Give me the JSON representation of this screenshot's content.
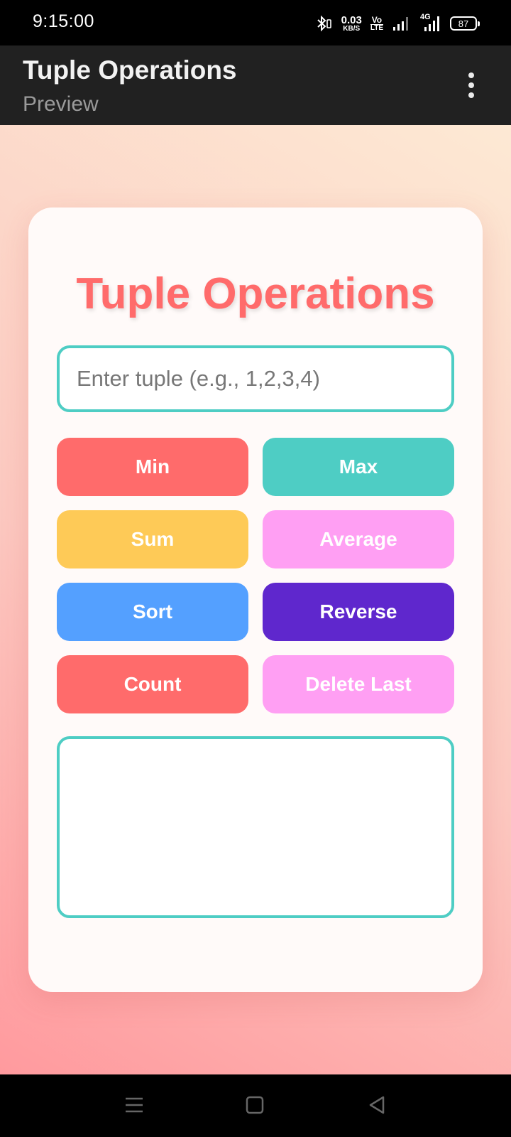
{
  "status_bar": {
    "time": "9:15:00",
    "net_speed_value": "0.03",
    "net_speed_unit": "KB/S",
    "volte_top": "Vo",
    "volte_bottom": "LTE",
    "network_type": "4G",
    "battery": "87",
    "icons": [
      "bluetooth-icon",
      "signal-icon",
      "signal-4g-icon",
      "battery-icon"
    ]
  },
  "app_bar": {
    "title": "Tuple Operations",
    "subtitle": "Preview",
    "menu_icon": "more-vertical-icon"
  },
  "card": {
    "title": "Tuple Operations",
    "input": {
      "value": "",
      "placeholder": "Enter tuple (e.g., 1,2,3,4)"
    },
    "buttons": [
      {
        "label": "Min",
        "color": "#ff6b6b"
      },
      {
        "label": "Max",
        "color": "#4ecdc4"
      },
      {
        "label": "Sum",
        "color": "#feca57"
      },
      {
        "label": "Average",
        "color": "#ff9ff3"
      },
      {
        "label": "Sort",
        "color": "#54a0ff"
      },
      {
        "label": "Reverse",
        "color": "#5f27cd"
      },
      {
        "label": "Count",
        "color": "#ff6b6b"
      },
      {
        "label": "Delete Last",
        "color": "#ff9ff3"
      }
    ],
    "result": ""
  },
  "colors": {
    "accent": "#ff6b6b",
    "border": "#4ecdc4"
  },
  "nav_bar": {
    "icons": [
      "menu-icon",
      "home-icon",
      "back-icon"
    ]
  }
}
